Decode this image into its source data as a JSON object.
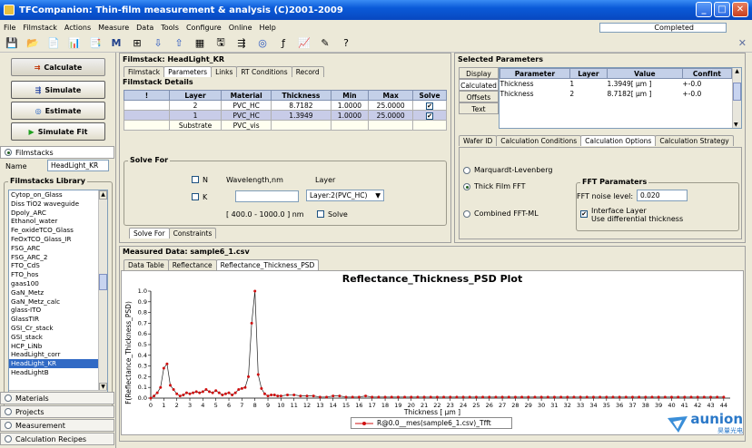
{
  "window": {
    "title": "TFCompanion: Thin-film measurement & analysis (C)2001-2009",
    "controls": [
      "_",
      "□",
      "✕"
    ]
  },
  "menu": [
    "File",
    "Filmstack",
    "Actions",
    "Measure",
    "Data",
    "Tools",
    "Configure",
    "Online",
    "Help"
  ],
  "status": {
    "text": "Completed"
  },
  "toolbar": [
    "💾",
    "📂",
    "📄",
    "📊",
    "📑",
    "M",
    "⊞",
    "⇩",
    "⇧",
    "▦",
    "🖫",
    "⇶",
    "◎",
    "ƒ",
    "📈",
    "✎",
    "?"
  ],
  "left": {
    "buttons": {
      "calculate": "Calculate",
      "simulate": "Simulate",
      "estimate": "Estimate",
      "simulate_fit": "Simulate Fit"
    },
    "filmstacks_label": "Filmstacks",
    "name_label": "Name",
    "name_value": "HeadLight_KR",
    "library_title": "Filmstacks Library",
    "library": [
      "Cytop_on_Glass",
      "Diss TiO2 waveguide",
      "Dpoly_ARC",
      "Ethanol_water",
      "Fe_oxideTCO_Glass",
      "FeOxTCO_Glass_IR",
      "FSG_ARC",
      "FSG_ARC_2",
      "FTO_CdS",
      "FTO_hos",
      "gaas100",
      "GaN_Metz",
      "GaN_Metz_calc",
      "glass-ITO",
      "GlassTIR",
      "GSI_Cr_stack",
      "GSI_stack",
      "HCP_LiNb",
      "HeadLight_corr",
      "HeadLight_KR",
      "HeadLightB"
    ],
    "selected_library_item": "HeadLight_KR",
    "nav": [
      "Materials",
      "Projects",
      "Measurement",
      "Calculation Recipes"
    ]
  },
  "filmstack": {
    "title": "Filmstack: HeadLight_KR",
    "tabs": [
      "Filmstack",
      "Parameters",
      "Links",
      "RT Conditions",
      "Record"
    ],
    "details_title": "Filmstack Details",
    "columns": [
      "!",
      "Layer",
      "Material",
      "Thickness",
      "Min",
      "Max",
      "Solve"
    ],
    "rows": [
      {
        "excl": "",
        "layer": "2",
        "material": "PVC_HC",
        "thickness": "8.7182",
        "min": "1.0000",
        "max": "25.0000",
        "solve": "✔"
      },
      {
        "excl": "",
        "layer": "1",
        "material": "PVC_HC",
        "thickness": "1.3949",
        "min": "1.0000",
        "max": "25.0000",
        "solve": "✔"
      },
      {
        "excl": "",
        "layer": "Substrate",
        "material": "PVC_vis",
        "thickness": "",
        "min": "",
        "max": "",
        "solve": ""
      }
    ],
    "solve_for": {
      "title": "Solve For",
      "n": "N",
      "k": "K",
      "wavelength_label": "Wavelength,nm",
      "layer_label": "Layer",
      "layer_value": "Layer:2(PVC_HC)",
      "range": "[ 400.0 - 1000.0 ] nm",
      "solve": "Solve"
    },
    "bottom_tabs": [
      "Solve For",
      "Constraints"
    ]
  },
  "selected": {
    "title": "Selected Parameters",
    "side_tabs": [
      "Display",
      "Calculated",
      "Offsets",
      "Text"
    ],
    "columns": [
      "Parameter",
      "Layer",
      "Value",
      "ConfInt"
    ],
    "rows": [
      {
        "parameter": "Thickness",
        "layer": "1",
        "value": "1.3949[ µm ]",
        "confint": "+-0.0"
      },
      {
        "parameter": "Thickness",
        "layer": "2",
        "value": "8.7182[ µm ]",
        "confint": "+-0.0"
      }
    ],
    "tabs": [
      "Wafer ID",
      "Calculation Conditions",
      "Calculation Options",
      "Calculation Strategy"
    ],
    "methods": [
      "Marquardt-Levenberg",
      "Thick Film FFT",
      "Combined FFT-ML"
    ],
    "selected_method": "Thick Film FFT",
    "fft": {
      "title": "FFT Paramaters",
      "noise_label": "FFT noise level:",
      "noise_value": "0.020",
      "interface_label": "Interface Layer",
      "interface_sub": "Use differential thickness"
    }
  },
  "measured": {
    "title": "Measured Data: sample6_1.csv",
    "tabs": [
      "Data Table",
      "Reflectance",
      "Reflectance_Thickness_PSD"
    ]
  },
  "chart_data": {
    "type": "line",
    "title": "Reflectance_Thickness_PSD Plot",
    "xlabel": "Thickness [ µm ]",
    "ylabel": "F(Reflectance_Thickness_PSD)",
    "xlim": [
      0,
      44.5
    ],
    "ylim": [
      0,
      1.0
    ],
    "xticks": [
      0,
      1,
      2,
      3,
      4,
      5,
      6,
      7,
      8,
      9,
      10,
      11,
      12,
      13,
      14,
      15,
      16,
      17,
      18,
      19,
      20,
      21,
      22,
      23,
      24,
      25,
      26,
      27,
      28,
      29,
      30,
      31,
      32,
      33,
      34,
      35,
      36,
      37,
      38,
      39,
      40,
      41,
      42,
      43,
      44
    ],
    "yticks": [
      0.0,
      0.1,
      0.2,
      0.3,
      0.4,
      0.5,
      0.6,
      0.7,
      0.8,
      0.9,
      1.0
    ],
    "series": [
      {
        "name": "R@0.0__mes(sample6_1.csv)_Tfft",
        "color": "#D01010",
        "x": [
          0,
          0.25,
          0.5,
          0.75,
          1.0,
          1.25,
          1.5,
          1.75,
          2.0,
          2.25,
          2.5,
          2.75,
          3.0,
          3.25,
          3.5,
          3.75,
          4.0,
          4.25,
          4.5,
          4.75,
          5.0,
          5.25,
          5.5,
          5.75,
          6.0,
          6.25,
          6.5,
          6.75,
          7.0,
          7.25,
          7.5,
          7.75,
          8.0,
          8.25,
          8.5,
          8.75,
          9.0,
          9.25,
          9.5,
          9.75,
          10.0,
          10.5,
          11,
          11.5,
          12,
          12.5,
          13,
          13.5,
          14,
          14.5,
          15,
          15.5,
          16,
          16.5,
          17,
          17.5,
          18,
          18.5,
          19,
          19.5,
          20,
          20.5,
          21,
          21.5,
          22,
          22.5,
          23,
          23.5,
          24,
          24.5,
          25,
          25.5,
          26,
          26.5,
          27,
          27.5,
          28,
          28.5,
          29,
          29.5,
          30,
          30.5,
          31,
          31.5,
          32,
          32.5,
          33,
          33.5,
          34,
          34.5,
          35,
          35.5,
          36,
          36.5,
          37,
          37.5,
          38,
          38.5,
          39,
          39.5,
          40,
          40.5,
          41,
          41.5,
          42,
          42.5,
          43,
          43.5,
          44
        ],
        "y": [
          0.0,
          0.02,
          0.05,
          0.1,
          0.28,
          0.32,
          0.12,
          0.08,
          0.04,
          0.02,
          0.03,
          0.05,
          0.04,
          0.05,
          0.06,
          0.05,
          0.06,
          0.08,
          0.06,
          0.05,
          0.07,
          0.05,
          0.03,
          0.04,
          0.05,
          0.03,
          0.05,
          0.08,
          0.09,
          0.1,
          0.2,
          0.7,
          1.0,
          0.22,
          0.09,
          0.04,
          0.02,
          0.03,
          0.03,
          0.02,
          0.02,
          0.03,
          0.03,
          0.02,
          0.02,
          0.02,
          0.01,
          0.01,
          0.02,
          0.02,
          0.01,
          0.01,
          0.01,
          0.02,
          0.01,
          0.01,
          0.01,
          0.01,
          0.01,
          0.01,
          0.01,
          0.01,
          0.01,
          0.01,
          0.01,
          0.01,
          0.01,
          0.01,
          0.01,
          0.01,
          0.01,
          0.01,
          0.01,
          0.01,
          0.01,
          0.01,
          0.01,
          0.01,
          0.01,
          0.01,
          0.01,
          0.01,
          0.01,
          0.01,
          0.01,
          0.01,
          0.01,
          0.01,
          0.01,
          0.01,
          0.01,
          0.01,
          0.01,
          0.01,
          0.01,
          0.01,
          0.01,
          0.01,
          0.01,
          0.01,
          0.01,
          0.01,
          0.01,
          0.01,
          0.01,
          0.01,
          0.01,
          0.01,
          0.01
        ]
      }
    ],
    "grid": false,
    "legend": "bottom-center"
  },
  "branding": {
    "logo": "aunion",
    "sub": "昊量光电"
  }
}
